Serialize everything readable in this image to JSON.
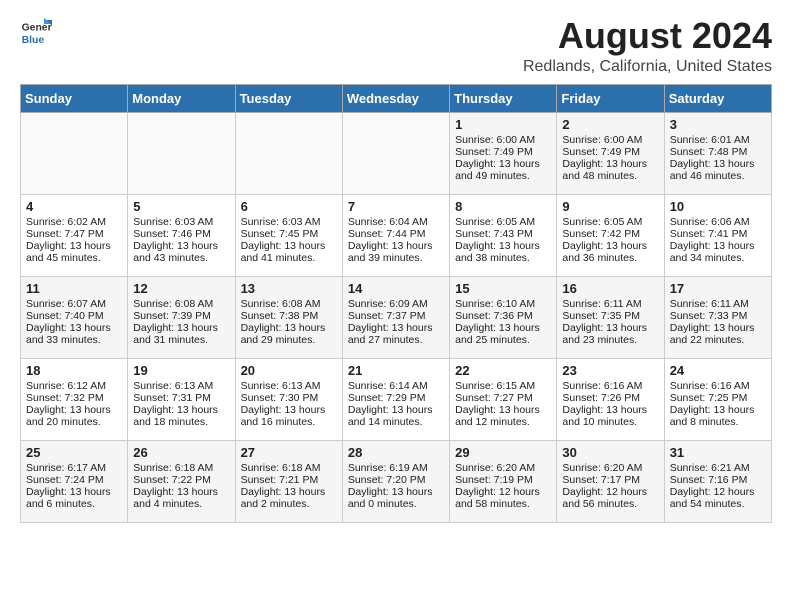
{
  "header": {
    "logo_line1": "General",
    "logo_line2": "Blue",
    "title": "August 2024",
    "subtitle": "Redlands, California, United States"
  },
  "days_of_week": [
    "Sunday",
    "Monday",
    "Tuesday",
    "Wednesday",
    "Thursday",
    "Friday",
    "Saturday"
  ],
  "weeks": [
    [
      {
        "day": "",
        "data": ""
      },
      {
        "day": "",
        "data": ""
      },
      {
        "day": "",
        "data": ""
      },
      {
        "day": "",
        "data": ""
      },
      {
        "day": "1",
        "data": "Sunrise: 6:00 AM\nSunset: 7:49 PM\nDaylight: 13 hours\nand 49 minutes."
      },
      {
        "day": "2",
        "data": "Sunrise: 6:00 AM\nSunset: 7:49 PM\nDaylight: 13 hours\nand 48 minutes."
      },
      {
        "day": "3",
        "data": "Sunrise: 6:01 AM\nSunset: 7:48 PM\nDaylight: 13 hours\nand 46 minutes."
      }
    ],
    [
      {
        "day": "4",
        "data": "Sunrise: 6:02 AM\nSunset: 7:47 PM\nDaylight: 13 hours\nand 45 minutes."
      },
      {
        "day": "5",
        "data": "Sunrise: 6:03 AM\nSunset: 7:46 PM\nDaylight: 13 hours\nand 43 minutes."
      },
      {
        "day": "6",
        "data": "Sunrise: 6:03 AM\nSunset: 7:45 PM\nDaylight: 13 hours\nand 41 minutes."
      },
      {
        "day": "7",
        "data": "Sunrise: 6:04 AM\nSunset: 7:44 PM\nDaylight: 13 hours\nand 39 minutes."
      },
      {
        "day": "8",
        "data": "Sunrise: 6:05 AM\nSunset: 7:43 PM\nDaylight: 13 hours\nand 38 minutes."
      },
      {
        "day": "9",
        "data": "Sunrise: 6:05 AM\nSunset: 7:42 PM\nDaylight: 13 hours\nand 36 minutes."
      },
      {
        "day": "10",
        "data": "Sunrise: 6:06 AM\nSunset: 7:41 PM\nDaylight: 13 hours\nand 34 minutes."
      }
    ],
    [
      {
        "day": "11",
        "data": "Sunrise: 6:07 AM\nSunset: 7:40 PM\nDaylight: 13 hours\nand 33 minutes."
      },
      {
        "day": "12",
        "data": "Sunrise: 6:08 AM\nSunset: 7:39 PM\nDaylight: 13 hours\nand 31 minutes."
      },
      {
        "day": "13",
        "data": "Sunrise: 6:08 AM\nSunset: 7:38 PM\nDaylight: 13 hours\nand 29 minutes."
      },
      {
        "day": "14",
        "data": "Sunrise: 6:09 AM\nSunset: 7:37 PM\nDaylight: 13 hours\nand 27 minutes."
      },
      {
        "day": "15",
        "data": "Sunrise: 6:10 AM\nSunset: 7:36 PM\nDaylight: 13 hours\nand 25 minutes."
      },
      {
        "day": "16",
        "data": "Sunrise: 6:11 AM\nSunset: 7:35 PM\nDaylight: 13 hours\nand 23 minutes."
      },
      {
        "day": "17",
        "data": "Sunrise: 6:11 AM\nSunset: 7:33 PM\nDaylight: 13 hours\nand 22 minutes."
      }
    ],
    [
      {
        "day": "18",
        "data": "Sunrise: 6:12 AM\nSunset: 7:32 PM\nDaylight: 13 hours\nand 20 minutes."
      },
      {
        "day": "19",
        "data": "Sunrise: 6:13 AM\nSunset: 7:31 PM\nDaylight: 13 hours\nand 18 minutes."
      },
      {
        "day": "20",
        "data": "Sunrise: 6:13 AM\nSunset: 7:30 PM\nDaylight: 13 hours\nand 16 minutes."
      },
      {
        "day": "21",
        "data": "Sunrise: 6:14 AM\nSunset: 7:29 PM\nDaylight: 13 hours\nand 14 minutes."
      },
      {
        "day": "22",
        "data": "Sunrise: 6:15 AM\nSunset: 7:27 PM\nDaylight: 13 hours\nand 12 minutes."
      },
      {
        "day": "23",
        "data": "Sunrise: 6:16 AM\nSunset: 7:26 PM\nDaylight: 13 hours\nand 10 minutes."
      },
      {
        "day": "24",
        "data": "Sunrise: 6:16 AM\nSunset: 7:25 PM\nDaylight: 13 hours\nand 8 minutes."
      }
    ],
    [
      {
        "day": "25",
        "data": "Sunrise: 6:17 AM\nSunset: 7:24 PM\nDaylight: 13 hours\nand 6 minutes."
      },
      {
        "day": "26",
        "data": "Sunrise: 6:18 AM\nSunset: 7:22 PM\nDaylight: 13 hours\nand 4 minutes."
      },
      {
        "day": "27",
        "data": "Sunrise: 6:18 AM\nSunset: 7:21 PM\nDaylight: 13 hours\nand 2 minutes."
      },
      {
        "day": "28",
        "data": "Sunrise: 6:19 AM\nSunset: 7:20 PM\nDaylight: 13 hours\nand 0 minutes."
      },
      {
        "day": "29",
        "data": "Sunrise: 6:20 AM\nSunset: 7:19 PM\nDaylight: 12 hours\nand 58 minutes."
      },
      {
        "day": "30",
        "data": "Sunrise: 6:20 AM\nSunset: 7:17 PM\nDaylight: 12 hours\nand 56 minutes."
      },
      {
        "day": "31",
        "data": "Sunrise: 6:21 AM\nSunset: 7:16 PM\nDaylight: 12 hours\nand 54 minutes."
      }
    ]
  ]
}
